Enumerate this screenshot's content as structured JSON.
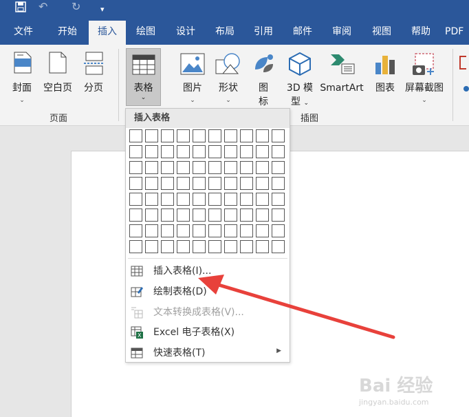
{
  "tabs": [
    "文件",
    "开始",
    "插入",
    "绘图",
    "设计",
    "布局",
    "引用",
    "邮件",
    "审阅",
    "视图",
    "帮助",
    "PDF"
  ],
  "active_tab": "插入",
  "ribbon": {
    "cover": "封面",
    "blank_page": "空白页",
    "page_break": "分页",
    "group_pages": "页面",
    "table": "表格",
    "pictures": "图片",
    "shapes": "形状",
    "icons_1": "图",
    "icons_2": "标",
    "model3d_1": "3D 模",
    "model3d_2": "型",
    "smartart": "SmartArt",
    "chart": "图表",
    "screenshot": "屏幕截图",
    "group_illustrations": "插图"
  },
  "dropdown": {
    "header": "插入表格",
    "grid_cols": 10,
    "grid_rows": 8,
    "items": [
      {
        "label": "插入表格(I)...",
        "icon": "table-icon",
        "enabled": true
      },
      {
        "label": "绘制表格(D)",
        "icon": "draw-table-icon",
        "enabled": true
      },
      {
        "label": "文本转换成表格(V)...",
        "icon": "convert-text-table-icon",
        "enabled": false
      },
      {
        "label": "Excel 电子表格(X)",
        "icon": "excel-sheet-icon",
        "enabled": true
      },
      {
        "label": "快速表格(T)",
        "icon": "quick-tables-icon",
        "enabled": true,
        "submenu": true
      }
    ]
  },
  "watermark": {
    "main": "Bai 经验",
    "sub": "jingyan.baidu.com"
  },
  "colors": {
    "accent": "#2b579a",
    "arrow": "#e8413b"
  }
}
